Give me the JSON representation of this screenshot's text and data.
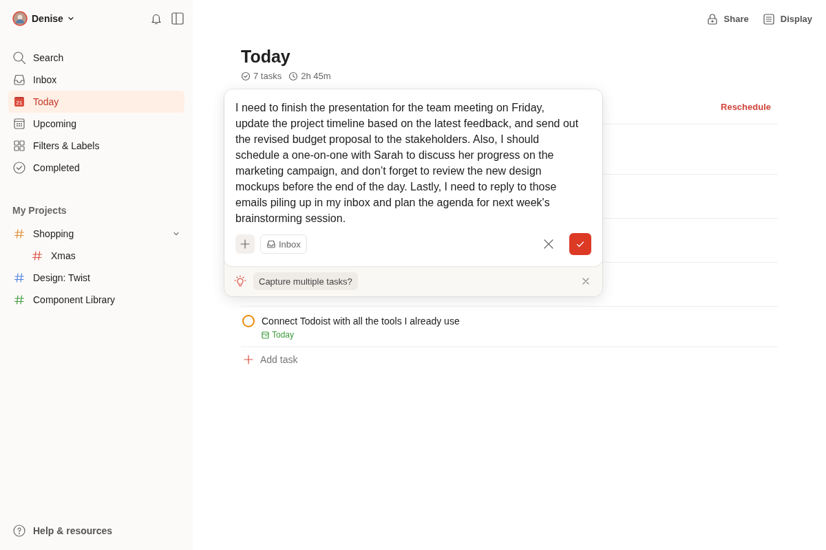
{
  "user": {
    "name": "Denise"
  },
  "nav": [
    {
      "kind": "search",
      "label": "Search",
      "selected": false
    },
    {
      "kind": "inbox",
      "label": "Inbox",
      "selected": false
    },
    {
      "kind": "today",
      "label": "Today",
      "selected": true,
      "icon_text": "21"
    },
    {
      "kind": "upcoming",
      "label": "Upcoming",
      "selected": false
    },
    {
      "kind": "filters",
      "label": "Filters & Labels",
      "selected": false
    },
    {
      "kind": "completed",
      "label": "Completed",
      "selected": false
    }
  ],
  "projects": {
    "heading": "My Projects",
    "items": [
      {
        "name": "Shopping",
        "color": "#e08a2c",
        "expanded": true,
        "children": [
          {
            "name": "Xmas",
            "color": "#dc4c3e"
          }
        ]
      },
      {
        "name": "Design: Twist",
        "color": "#4a7fe0"
      },
      {
        "name": "Component Library",
        "color": "#3f9a3f"
      }
    ]
  },
  "help": "Help & resources",
  "toolbar": [
    {
      "kind": "share",
      "label": "Share"
    },
    {
      "kind": "display",
      "label": "Display"
    }
  ],
  "page": {
    "title": "Today",
    "task_count": "7 tasks",
    "duration": "2h 45m",
    "reschedule": "Reschedule"
  },
  "tasks": [
    {
      "title": "Connect Todoist with all the tools I already use",
      "due": "Today",
      "color": "#eb8909"
    }
  ],
  "add_task": "Add task",
  "quick_add": {
    "text": "I need to finish the presentation for the team meeting on Friday, update the project timeline based on the latest feedback, and send out the revised budget proposal to the stakeholders. Also, I should schedule a one-on-one with Sarah to discuss her progress on the marketing campaign, and don’t forget to review the new design mockups before the end of the day. Lastly, I need to reply to those emails piling up in my inbox and plan the agenda for next week's brainstorming session.",
    "project": "Inbox",
    "suggestion": "Capture multiple tasks?"
  }
}
